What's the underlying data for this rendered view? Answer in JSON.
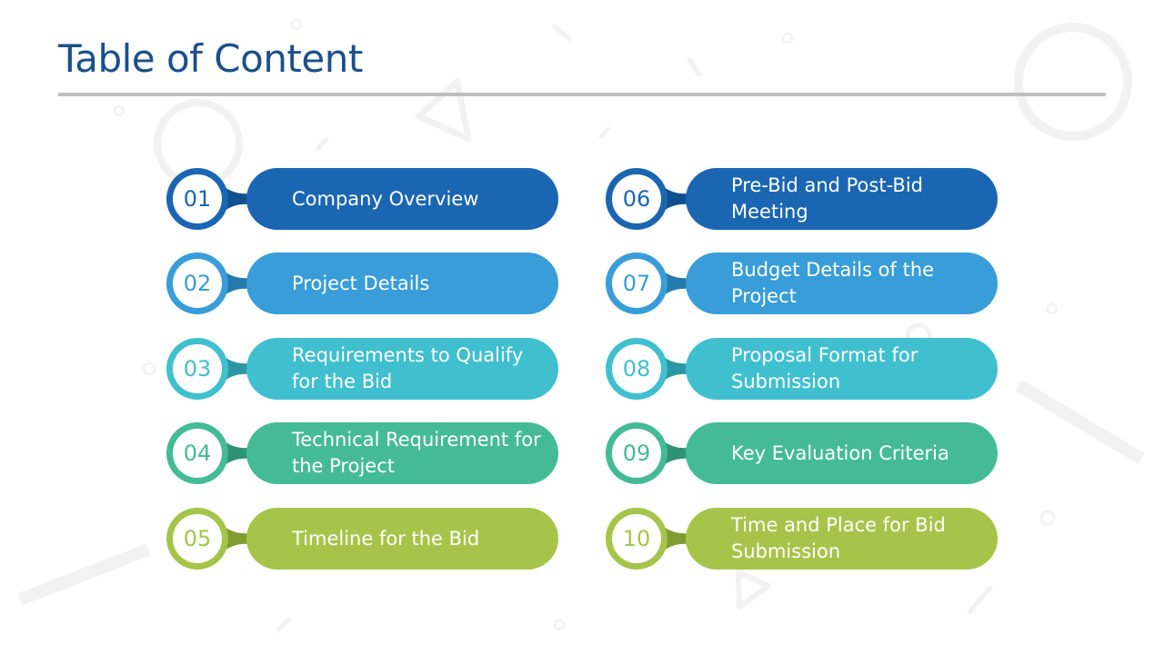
{
  "slide": {
    "title": "Table of Content"
  },
  "theme": {
    "title_color": "#1B4F8A",
    "rule_color": "#BFBFBF",
    "row_colors": [
      {
        "fill": "#1A66B2",
        "connector": "#10508F"
      },
      {
        "fill": "#389DD8",
        "connector": "#2479AD"
      },
      {
        "fill": "#40BFCF",
        "connector": "#2B97A4"
      },
      {
        "fill": "#45BB95",
        "connector": "#2F9373"
      },
      {
        "fill": "#A6C44A",
        "connector": "#7F9C30"
      }
    ]
  },
  "items": [
    {
      "number": "01",
      "label": "Company Overview"
    },
    {
      "number": "02",
      "label": "Project Details"
    },
    {
      "number": "03",
      "label": "Requirements to Qualify for the Bid"
    },
    {
      "number": "04",
      "label": "Technical Requirement for the Project"
    },
    {
      "number": "05",
      "label": "Timeline for the Bid"
    },
    {
      "number": "06",
      "label": "Pre-Bid and Post-Bid Meeting"
    },
    {
      "number": "07",
      "label": "Budget Details of the Project"
    },
    {
      "number": "08",
      "label": "Proposal Format for Submission"
    },
    {
      "number": "09",
      "label": "Key Evaluation Criteria"
    },
    {
      "number": "10",
      "label": "Time and Place for Bid Submission"
    }
  ]
}
